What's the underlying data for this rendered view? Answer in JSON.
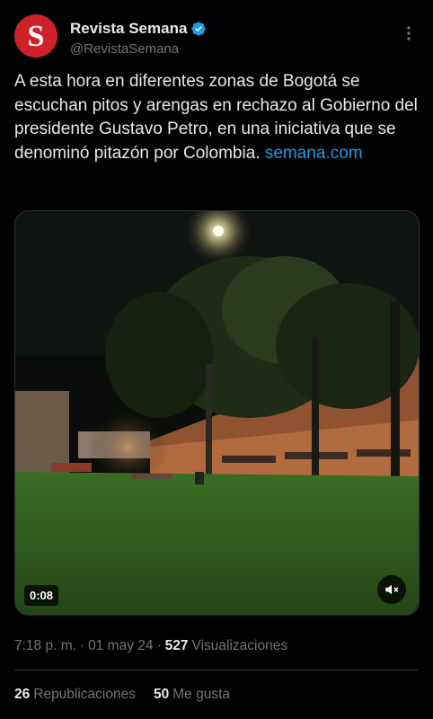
{
  "account": {
    "avatar_letter": "S",
    "avatar_color": "#d0202a",
    "display_name": "Revista Semana",
    "verified": true,
    "verified_icon": "verified-badge-icon",
    "handle": "@RevistaSemana"
  },
  "tweet": {
    "text": "A esta hora en diferentes zonas de Bogotá se escuchan pitos y arengas en rechazo al Gobierno del presidente Gustavo Petro, en una iniciativa que se denominó pitazón por Colombia.",
    "link": "semana.com",
    "link_color": "#1d9bf0"
  },
  "media": {
    "type": "video",
    "duration": "0:08",
    "mute_icon": "speaker-muted-icon"
  },
  "meta": {
    "time": "7:18 p. m.",
    "separator": "·",
    "date": "01 may 24",
    "views_count": "527",
    "views_label": "Visualizaciones"
  },
  "stats": {
    "reposts_count": "26",
    "reposts_label": "Republicaciones",
    "likes_count": "50",
    "likes_label": "Me gusta"
  },
  "colors": {
    "background": "#000000",
    "text": "#e7e9ea",
    "secondary": "#71767b",
    "accent": "#1d9bf0"
  }
}
